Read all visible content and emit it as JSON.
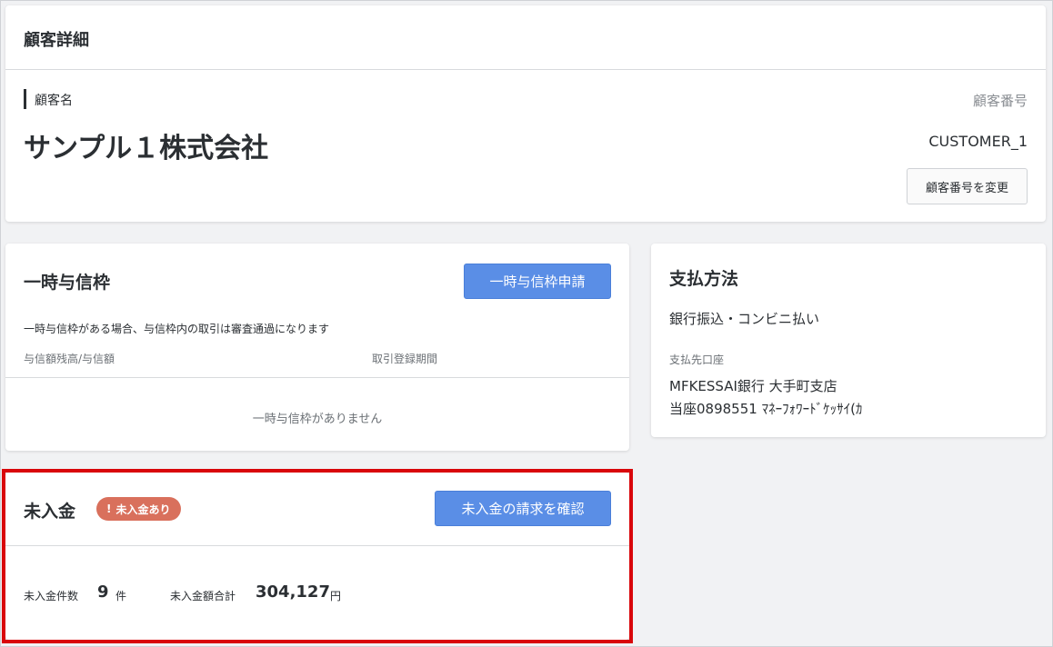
{
  "customer_detail": {
    "title": "顧客詳細",
    "name_label": "顧客名",
    "name_value": "サンプル１株式会社",
    "number_label": "顧客番号",
    "number_value": "CUSTOMER_1",
    "change_number_button": "顧客番号を変更"
  },
  "temp_credit": {
    "title": "一時与信枠",
    "apply_button": "一時与信枠申請",
    "description": "一時与信枠がある場合、与信枠内の取引は審査通過になります",
    "col_balance": "与信額残高/与信額",
    "col_period": "取引登録期間",
    "empty_message": "一時与信枠がありません"
  },
  "payment": {
    "title": "支払方法",
    "method": "銀行振込・コンビニ払い",
    "account_label": "支払先口座",
    "bank_line": "MFKESSAI銀行 大手町支店",
    "account_line": "当座0898551 ﾏﾈｰﾌｫﾜｰﾄﾞｹｯｻｲ(ｶ"
  },
  "unpaid": {
    "title": "未入金",
    "badge_label": "未入金あり",
    "badge_icon": "!",
    "confirm_button": "未入金の請求を確認",
    "count_label": "未入金件数",
    "count_value": "9",
    "count_unit": "件",
    "total_label": "未入金額合計",
    "total_value": "304,127",
    "total_unit": "円"
  },
  "colors": {
    "primary_button": "#5a8ee6",
    "badge": "#d9705c",
    "highlight": "#d9070b"
  }
}
